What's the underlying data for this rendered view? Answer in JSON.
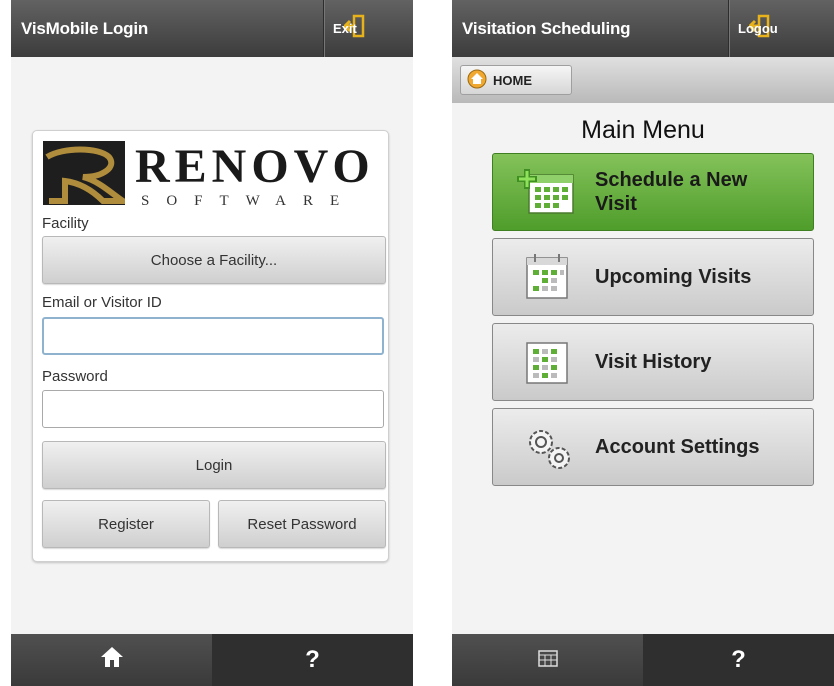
{
  "login_screen": {
    "title": "VisMobile Login",
    "exit_label": "Exit",
    "logo": {
      "brand": "RENOVO",
      "subtitle": "SOFTWARE"
    },
    "facility_label": "Facility",
    "facility_button": "Choose a Facility...",
    "email_label": "Email or Visitor ID",
    "email_value": "",
    "password_label": "Password",
    "password_value": "",
    "login_button": "Login",
    "register_button": "Register",
    "reset_button": "Reset Password",
    "bottom": {
      "help": "?"
    }
  },
  "scheduling_screen": {
    "title": "Visitation Scheduling",
    "logout_label": "Logou",
    "home_button": "HOME",
    "menu_title": "Main Menu",
    "menu_items": [
      {
        "label_line1": "Schedule a New",
        "label_line2": "Visit",
        "icon": "calendar-add-icon"
      },
      {
        "label_line1": "Upcoming Visits",
        "label_line2": "",
        "icon": "calendar-icon"
      },
      {
        "label_line1": "Visit History",
        "label_line2": "",
        "icon": "calendar-history-icon"
      },
      {
        "label_line1": "Account Settings",
        "label_line2": "",
        "icon": "gears-icon"
      }
    ],
    "bottom": {
      "help": "?"
    }
  },
  "colors": {
    "accent_green": "#5fae35",
    "exit_icon": "#e8b21a"
  }
}
